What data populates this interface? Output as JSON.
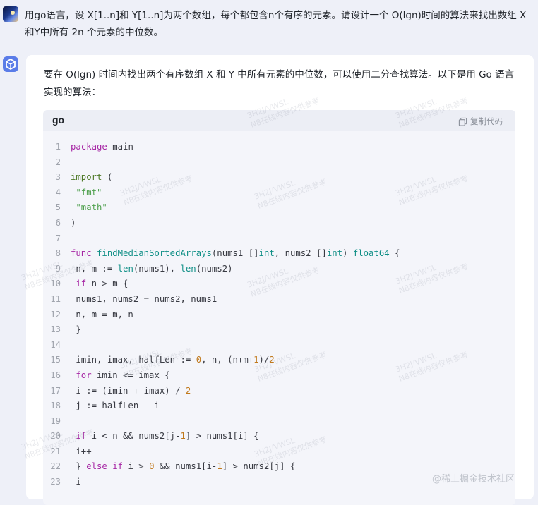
{
  "user_message": {
    "text": "用go语言，设 X[1..n]和 Y[1..n]为两个数组，每个都包含n个有序的元素。请设计一个 O(lgn)时间的算法来找出数组 X和Y中所有 2n 个元素的中位数。"
  },
  "answer": {
    "intro": "要在 O(lgn) 时间内找出两个有序数组 X 和 Y 中所有元素的中位数，可以使用二分查找算法。以下是用 Go 语言实现的算法：",
    "code_language": "go",
    "copy_label": "复制代码",
    "code_lines": [
      {
        "n": "1",
        "html": "<span class=\"kw\">package</span> main"
      },
      {
        "n": "2",
        "html": ""
      },
      {
        "n": "3",
        "html": "<span class=\"kg\">import</span> ("
      },
      {
        "n": "4",
        "html": " <span class=\"str\">\"fmt\"</span>"
      },
      {
        "n": "5",
        "html": " <span class=\"str\">\"math\"</span>"
      },
      {
        "n": "6",
        "html": ")"
      },
      {
        "n": "7",
        "html": ""
      },
      {
        "n": "8",
        "html": "<span class=\"kw\">func</span> <span class=\"fn\">findMedianSortedArrays</span>(nums1 []<span class=\"bi\">int</span>, nums2 []<span class=\"bi\">int</span>) <span class=\"bi\">float64</span> {"
      },
      {
        "n": "9",
        "html": " n, m := <span class=\"bi\">len</span>(nums1), <span class=\"bi\">len</span>(nums2)"
      },
      {
        "n": "10",
        "html": " <span class=\"kw\">if</span> n &gt; m {"
      },
      {
        "n": "11",
        "html": " nums1, nums2 = nums2, nums1"
      },
      {
        "n": "12",
        "html": " n, m = m, n"
      },
      {
        "n": "13",
        "html": " }"
      },
      {
        "n": "14",
        "html": ""
      },
      {
        "n": "15",
        "html": " imin, imax, halfLen := <span class=\"num\">0</span>, n, (n+m+<span class=\"num\">1</span>)/<span class=\"num\">2</span>"
      },
      {
        "n": "16",
        "html": " <span class=\"kw\">for</span> imin &lt;= imax {"
      },
      {
        "n": "17",
        "html": " i := (imin + imax) / <span class=\"num\">2</span>"
      },
      {
        "n": "18",
        "html": " j := halfLen - i"
      },
      {
        "n": "19",
        "html": ""
      },
      {
        "n": "20",
        "html": " <span class=\"kw\">if</span> i &lt; n &amp;&amp; nums2[j-<span class=\"num\">1</span>] &gt; nums1[i] {"
      },
      {
        "n": "21",
        "html": " i++"
      },
      {
        "n": "22",
        "html": " } <span class=\"kw\">else</span> <span class=\"kw\">if</span> i &gt; <span class=\"num\">0</span> &amp;&amp; nums1[i-<span class=\"num\">1</span>] &gt; nums2[j] {"
      },
      {
        "n": "23",
        "html": " i--"
      }
    ]
  },
  "watermark_text": "3H2J/VWSL\nN8在线内容仅供参考",
  "site_watermark": "@稀土掘金技术社区",
  "icons": {
    "user_avatar": "avatar-image",
    "bot_avatar": "cube-logo-icon",
    "copy": "copy-icon"
  },
  "colors": {
    "background": "#eef0f8",
    "card": "#ffffff",
    "code_bg": "#f4f5fa",
    "bot_avatar": "#5a7ce8"
  }
}
